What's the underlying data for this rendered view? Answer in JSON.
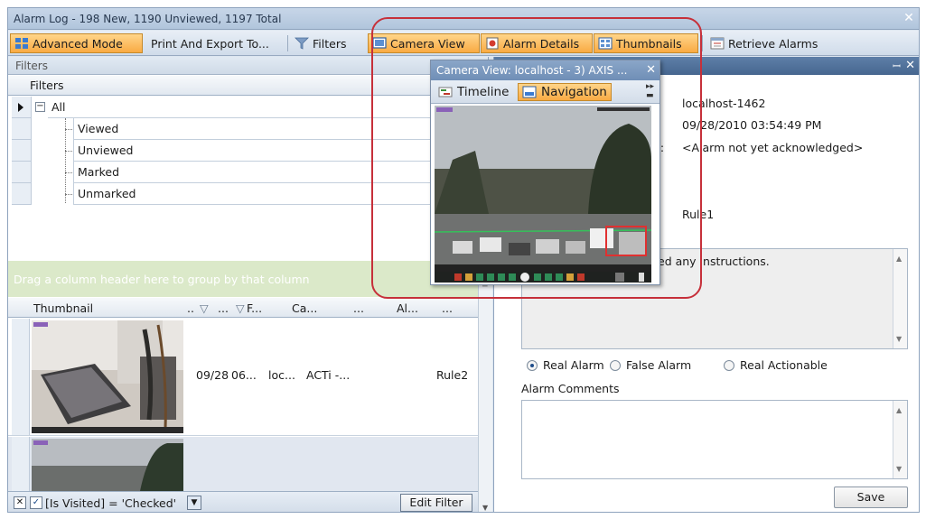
{
  "window": {
    "title": "Alarm Log - 198 New, 1190 Unviewed, 1197 Total",
    "close_glyph": "✕"
  },
  "toolbar": {
    "advanced_mode": "Advanced Mode",
    "print_export": "Print And Export To...",
    "filters": "Filters",
    "camera_view": "Camera View",
    "alarm_details": "Alarm Details",
    "thumbnails": "Thumbnails",
    "retrieve_alarms": "Retrieve Alarms"
  },
  "filters_panel": {
    "header": "Filters",
    "grid_header": "Filters",
    "tree": {
      "root": "All",
      "children": [
        "Viewed",
        "Unviewed",
        "Marked",
        "Unmarked"
      ]
    }
  },
  "alarm_grid": {
    "group_hint": "Drag a column header here to group by that column",
    "columns": [
      "Thumbnail",
      "..",
      "...",
      "F...",
      "Ca...",
      "...",
      "Al...",
      "..."
    ],
    "rows": [
      {
        "date": "09/28",
        "time": "06...",
        "server": "loc...",
        "camera": "ACTi -...",
        "rule": "Rule2"
      }
    ],
    "filter_expression": "[Is Visited] = 'Checked'",
    "edit_filter": "Edit Filter"
  },
  "details": {
    "server": "localhost-1462",
    "timestamp": "09/28/2010 03:54:49 PM",
    "ack_label": "t:",
    "acknowledged": "<Alarm not yet acknowledged>",
    "rule": "Rule1",
    "instructions": "ed any instructions.",
    "radio_options": [
      "Real Alarm",
      "False Alarm",
      "Real Actionable"
    ],
    "selected_radio": "Real Alarm",
    "comments_label": "Alarm Comments",
    "save": "Save"
  },
  "camera_popup": {
    "title": "Camera View: localhost - 3) AXIS ...",
    "tabs": [
      "Timeline",
      "Navigation"
    ],
    "active_tab": "Navigation"
  },
  "colors": {
    "accent_orange": "#f9aa43",
    "highlight_red": "#c6303a",
    "titlebar_blue": "#b1c5dc",
    "group_bar_green": "#dbe9c9"
  }
}
